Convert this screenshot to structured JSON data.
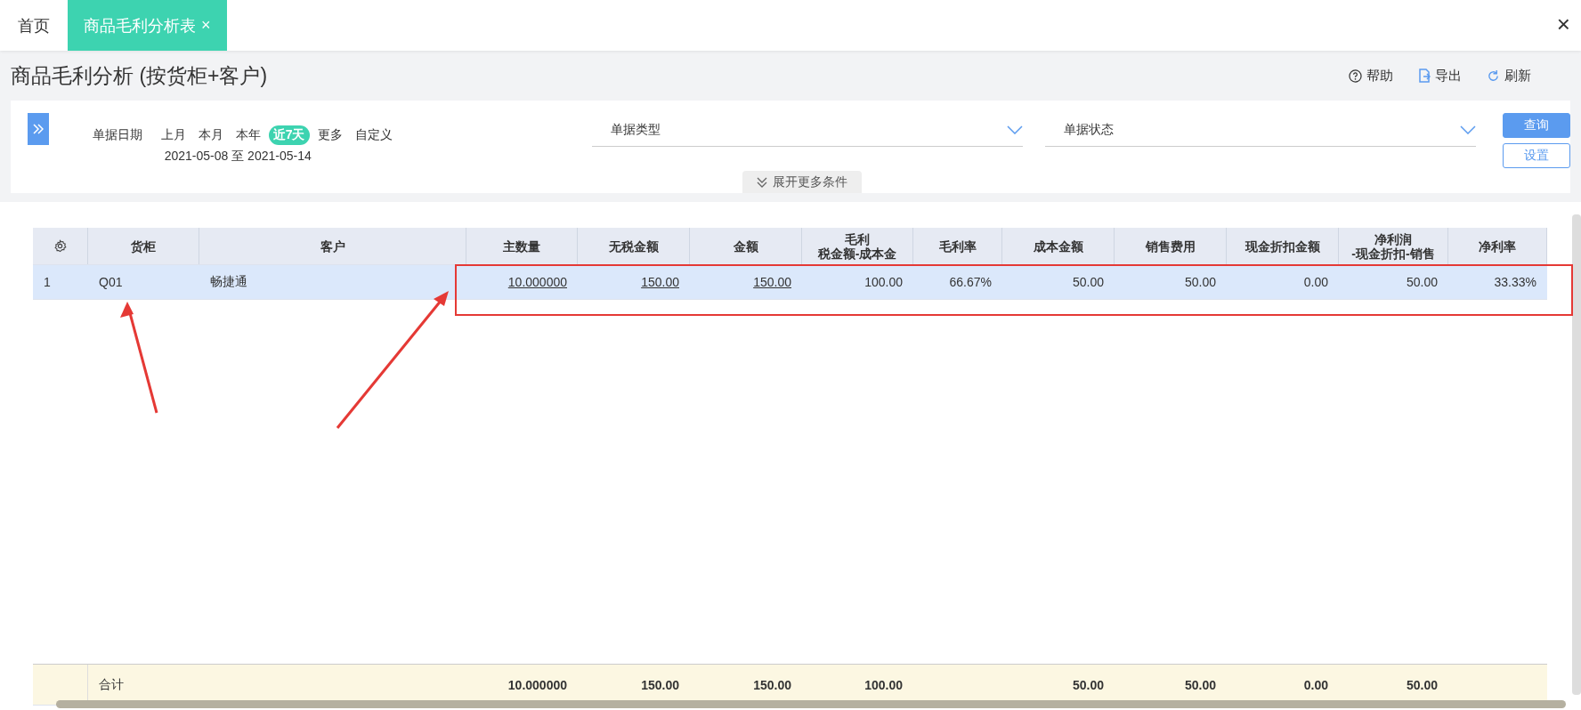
{
  "tabs": [
    {
      "label": "首页",
      "selected": false,
      "closable": false
    },
    {
      "label": "商品毛利分析表",
      "selected": true,
      "closable": true
    }
  ],
  "close_symbol": "×",
  "page_title": "商品毛利分析 (按货柜+客户)",
  "toolbar": [
    {
      "kind": "help",
      "label": "帮助"
    },
    {
      "kind": "export",
      "label": "导出"
    },
    {
      "kind": "refresh",
      "label": "刷新"
    }
  ],
  "filters": {
    "date": {
      "label": "单据日期",
      "range": "2021-05-08 至 2021-05-14",
      "presets": [
        {
          "label": "上月",
          "selected": false
        },
        {
          "label": "本月",
          "selected": false
        },
        {
          "label": "本年",
          "selected": false
        },
        {
          "label": "近7天",
          "selected": true
        },
        {
          "label": "更多",
          "selected": false
        },
        {
          "label": "自定义",
          "selected": false
        }
      ]
    },
    "selects": [
      {
        "label": "单据类型"
      },
      {
        "label": "单据状态"
      }
    ],
    "expand_label": "展开更多条件",
    "query_button": "查询",
    "settings_button": "设置"
  },
  "table": {
    "columns": [
      {
        "title": "货柜",
        "kind": "text"
      },
      {
        "title": "客户",
        "kind": "text"
      },
      {
        "title": "主数量",
        "kind": "link"
      },
      {
        "title": "无税金额",
        "kind": "link"
      },
      {
        "title": "金额",
        "kind": "link"
      },
      {
        "title": "毛利",
        "subtitle": "税金额-成本金",
        "kind": "number"
      },
      {
        "title": "毛利率",
        "kind": "number"
      },
      {
        "title": "成本金额",
        "kind": "number"
      },
      {
        "title": "销售费用",
        "kind": "number"
      },
      {
        "title": "现金折扣金额",
        "kind": "number"
      },
      {
        "title": "净利润",
        "subtitle": "-现金折扣-销售",
        "kind": "number"
      },
      {
        "title": "净利率",
        "kind": "number"
      }
    ],
    "rows": [
      {
        "index": "1",
        "selected": true,
        "cells": [
          "Q01",
          "畅捷通",
          "10.000000",
          "150.00",
          "150.00",
          "100.00",
          "66.67%",
          "50.00",
          "50.00",
          "0.00",
          "50.00",
          "33.33%"
        ]
      }
    ],
    "summary": {
      "cells": [
        "合计",
        null,
        "10.000000",
        "150.00",
        "150.00",
        "100.00",
        null,
        "50.00",
        "50.00",
        "0.00",
        "50.00",
        null
      ]
    }
  }
}
